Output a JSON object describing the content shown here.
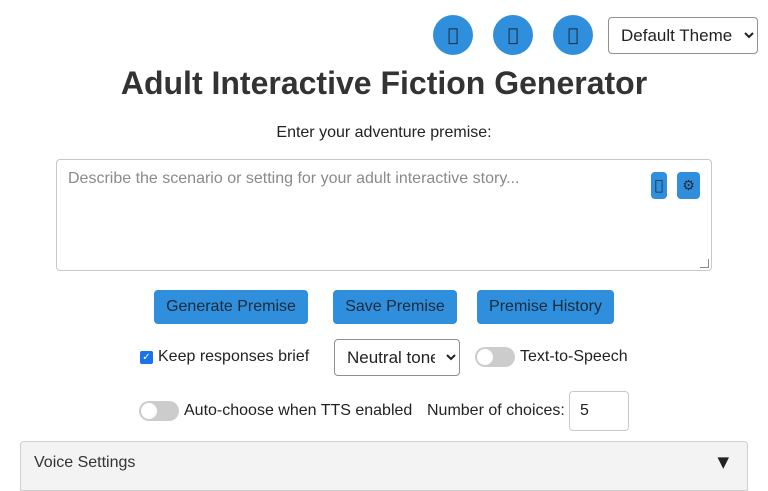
{
  "header": {
    "icon_buttons": [
      {
        "icon": "info-icon",
        "glyph": ""
      },
      {
        "icon": "help-icon",
        "glyph": ""
      },
      {
        "icon": "settings-icon",
        "glyph": ""
      }
    ],
    "theme_select": {
      "value": "Default Theme"
    }
  },
  "page_title": "Adult Interactive Fiction Generator",
  "premise": {
    "label": "Enter your adventure premise:",
    "placeholder": "Describe the scenario or setting for your adult interactive story...",
    "value": "",
    "mic_glyph": "",
    "gear_glyph": "⚙"
  },
  "actions": {
    "generate_label": "Generate Premise",
    "save_label": "Save Premise",
    "history_label": "Premise History"
  },
  "options": {
    "brief_label": "Keep responses brief",
    "brief_checked": true,
    "tone_value": "Neutral tone",
    "tts_label": "Text-to-Speech",
    "tts_enabled": false,
    "autochoose_label": "Auto-choose when TTS enabled",
    "autochoose_enabled": false,
    "choices_label": "Number of choices:",
    "choices_value": "5"
  },
  "voice_settings": {
    "label": "Voice Settings",
    "arrow": "▼"
  },
  "colors": {
    "accent": "#2f8fdc",
    "toggle_off": "#cccccc"
  }
}
